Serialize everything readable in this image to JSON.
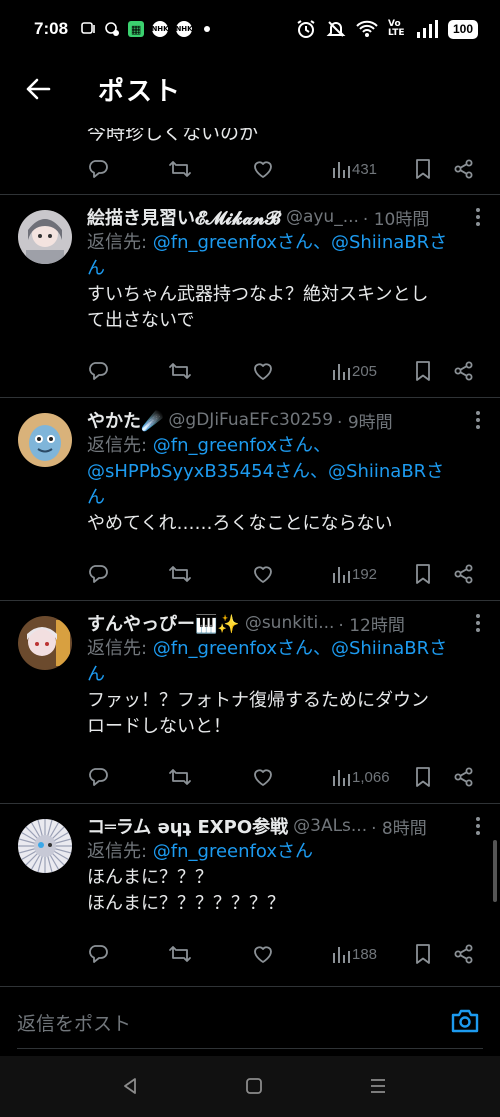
{
  "status_bar": {
    "time": "7:08",
    "icons_left": [
      "notification-icon",
      "chat-icon",
      "grid-app-icon",
      "nhk-icon",
      "nhk-plus-icon",
      "dot-icon"
    ],
    "nhk_label": "NHK",
    "nhk2_label": "NHK",
    "volte": "Vo LTE",
    "battery": "100"
  },
  "header": {
    "title": "ポスト"
  },
  "partial_post": {
    "text": "今時珍しくないのか",
    "views": "431"
  },
  "replies": [
    {
      "name": "絵描き見習い𝓔𝓜𝓲𝓴𝓪𝓷𝓑",
      "handle": "@ayu_...",
      "time": "· 10時間",
      "reply_prefix": "返信先: ",
      "reply_lines": [
        [
          "@fn_greenfoxさん、@ShiinaBRさ"
        ],
        [
          "ん"
        ]
      ],
      "content_lines": [
        "すいちゃん武器持つなよ？絶対スキンとし",
        "て出さないで"
      ],
      "views": "205"
    },
    {
      "name": "やかた☄️",
      "handle": "@gDJiFuaEFc30259",
      "time": "· 9時間",
      "reply_prefix": "返信先: ",
      "reply_lines": [
        [
          "@fn_greenfoxさん、"
        ],
        [
          "@sHPPbSyyxB35454さん、@ShiinaBRさ"
        ],
        [
          "ん"
        ]
      ],
      "content_lines": [
        "やめてくれ……ろくなことにならない"
      ],
      "views": "192"
    },
    {
      "name": "すんやっぴー🎹✨",
      "handle": "@sunkiti...",
      "time": "· 12時間",
      "reply_prefix": "返信先: ",
      "reply_lines": [
        [
          "@fn_greenfoxさん、@ShiinaBRさ"
        ],
        [
          "ん"
        ]
      ],
      "content_lines": [
        "ファッ！？フォトナ復帰するためにダウン",
        "ロードしないと！"
      ],
      "views": "1,066"
    },
    {
      "name": "コ═ラム ǝɥʇ EXPO参戦",
      "handle": "@3ALs...",
      "time": "· 8時間",
      "reply_prefix": "返信先: ",
      "reply_lines": [
        [
          "@fn_greenfoxさん"
        ]
      ],
      "content_lines": [
        "ほんまに？？？",
        "ほんまに？？？？？？？"
      ],
      "views": "188"
    }
  ],
  "reply_bar": {
    "placeholder": "返信をポスト"
  },
  "colors": {
    "background": "#000000",
    "accent": "#1d9bf0",
    "muted": "#71767b",
    "divider": "#2f3336"
  }
}
